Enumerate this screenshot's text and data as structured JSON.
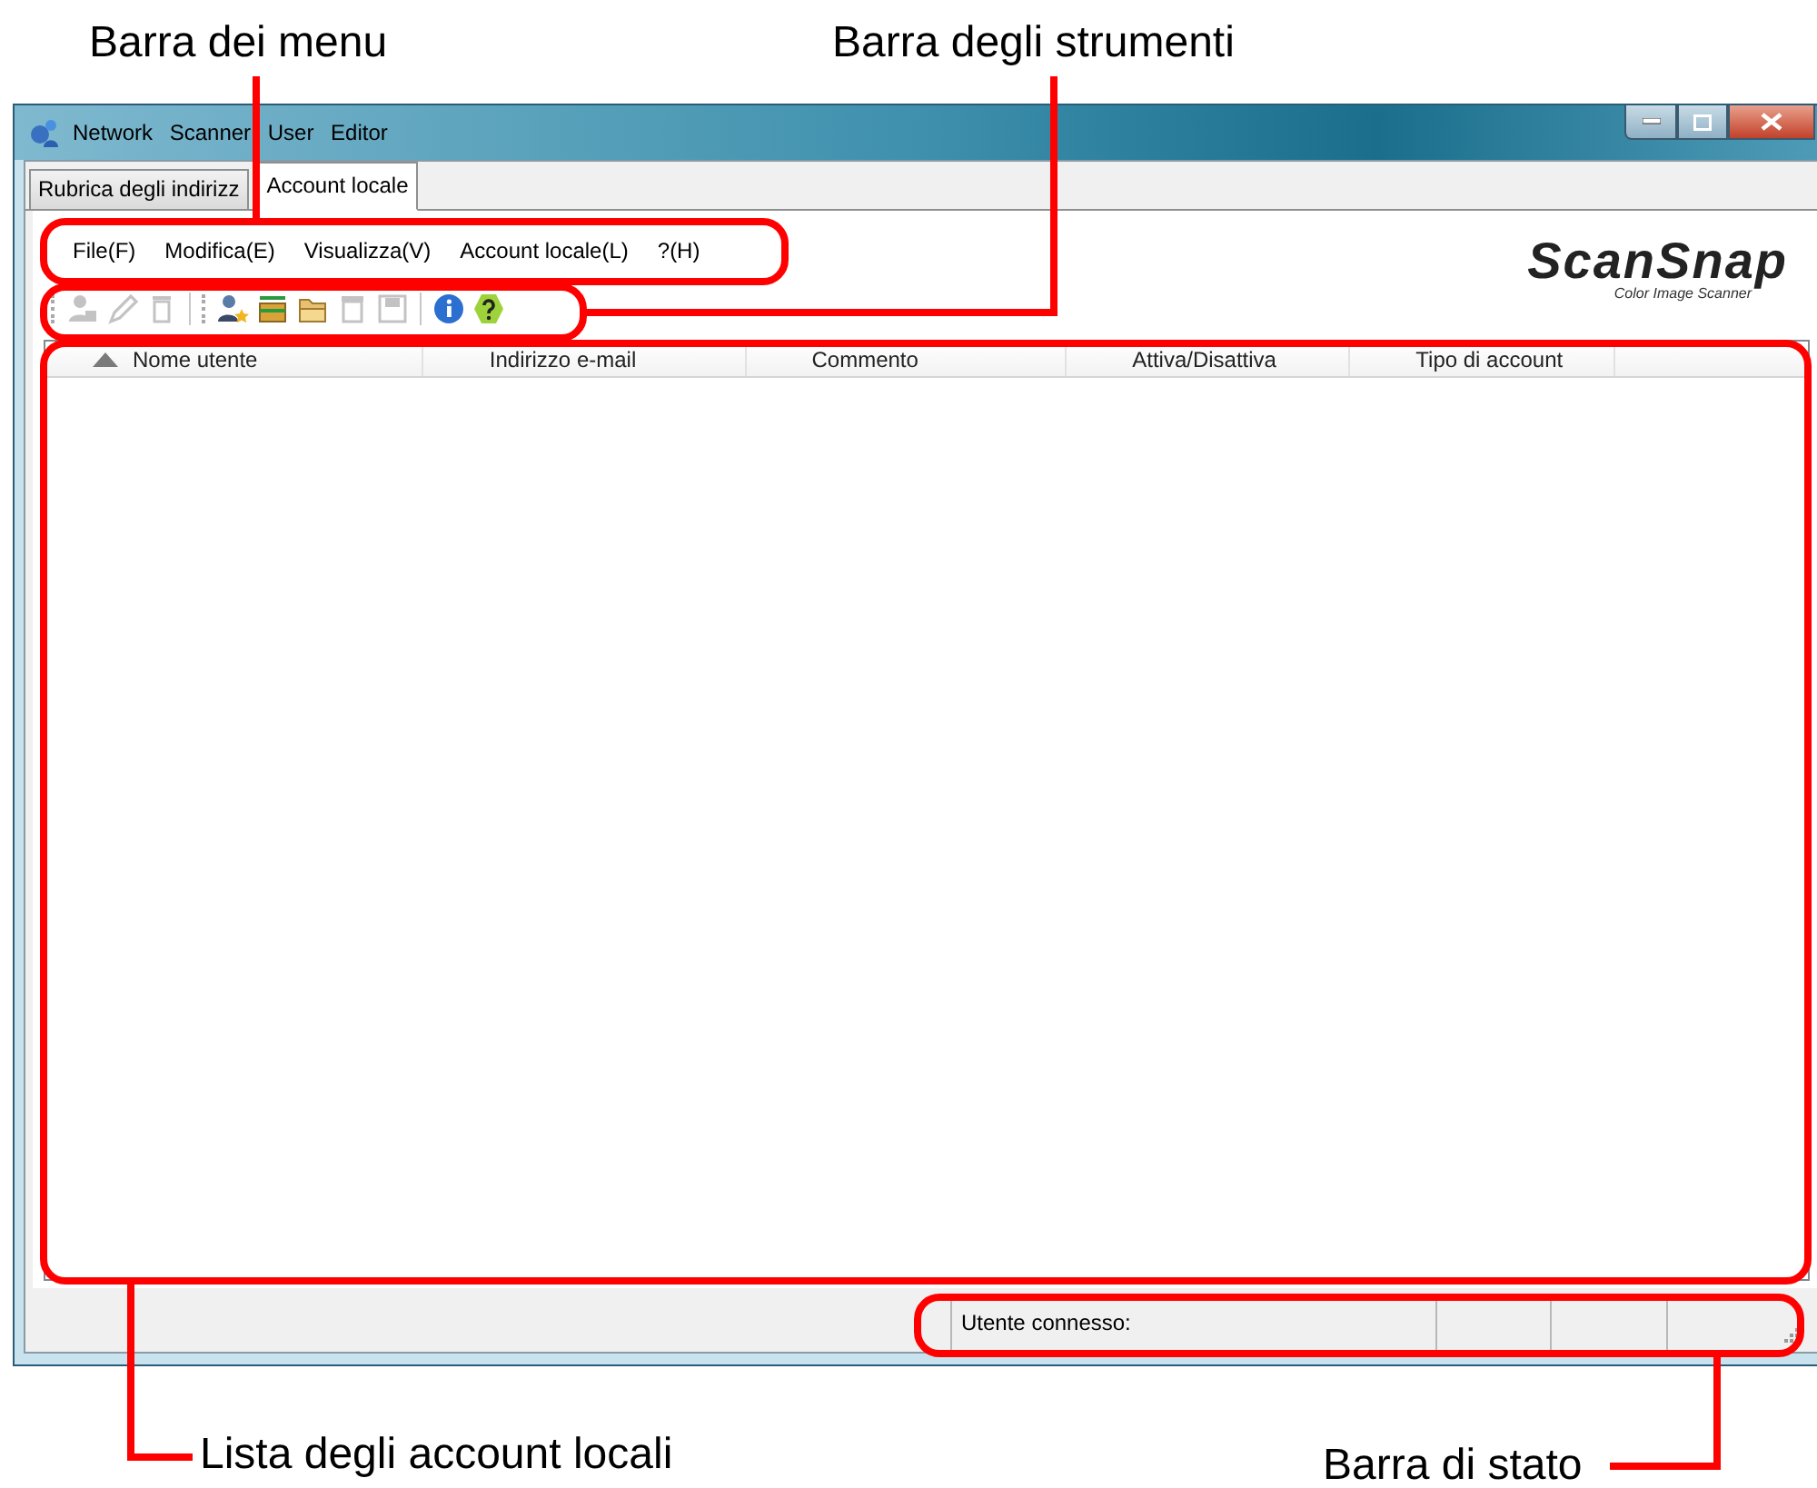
{
  "callouts": {
    "menu_bar": "Barra dei menu",
    "toolbar": "Barra degli strumenti",
    "account_list": "Lista degli account locali",
    "status_bar": "Barra di stato"
  },
  "window": {
    "title": "Network Scanner User Editor"
  },
  "tabs": [
    {
      "label": "Rubrica degli indirizz",
      "selected": false
    },
    {
      "label": "Account locale",
      "selected": true
    }
  ],
  "menu": [
    "File(F)",
    "Modifica(E)",
    "Visualizza(V)",
    "Account locale(L)",
    "?(H)"
  ],
  "logo": {
    "name": "ScanSnap",
    "tagline": "Color Image Scanner"
  },
  "toolbar": [
    {
      "kind": "adduser",
      "disabled": true
    },
    {
      "kind": "edit",
      "disabled": true
    },
    {
      "kind": "delete",
      "disabled": true
    },
    {
      "kind": "import",
      "disabled": false
    },
    {
      "kind": "export",
      "disabled": false
    },
    {
      "kind": "open",
      "disabled": false
    },
    {
      "kind": "clear",
      "disabled": true
    },
    {
      "kind": "save",
      "disabled": true
    },
    {
      "kind": "info",
      "disabled": false
    },
    {
      "kind": "help",
      "disabled": false
    }
  ],
  "table": {
    "columns": [
      {
        "label": "Nome utente",
        "sorted": true
      },
      {
        "label": "Indirizzo e-mail",
        "sorted": false
      },
      {
        "label": "Commento",
        "sorted": false
      },
      {
        "label": "Attiva/Disattiva",
        "sorted": false
      },
      {
        "label": "Tipo di account",
        "sorted": false
      }
    ]
  },
  "status_bar": {
    "user_label": "Utente connesso:"
  }
}
